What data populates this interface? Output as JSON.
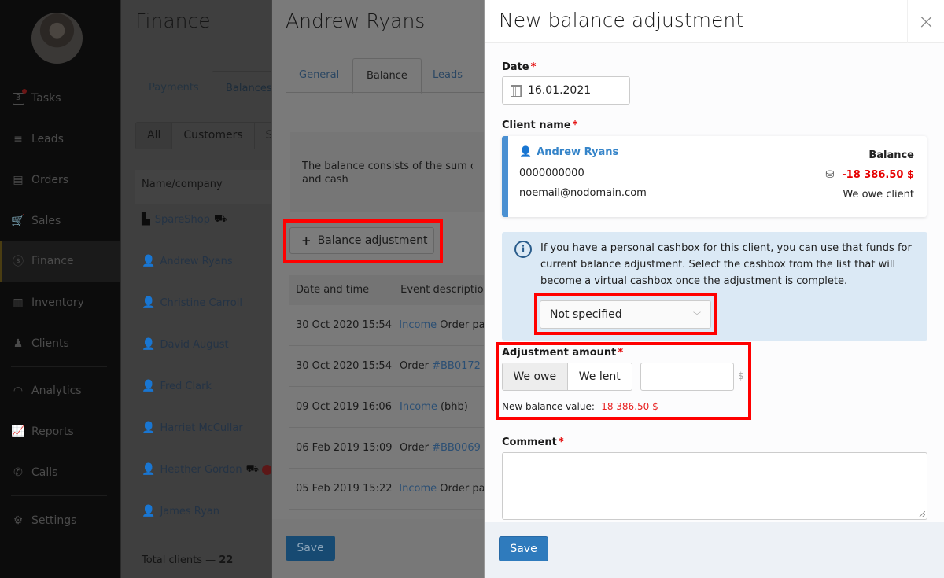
{
  "sidebar": {
    "tasks_count": "3",
    "items": [
      {
        "label": "Tasks",
        "icon": "tasks-icon"
      },
      {
        "label": "Leads",
        "icon": "funnel-icon"
      },
      {
        "label": "Orders",
        "icon": "orders-icon"
      },
      {
        "label": "Sales",
        "icon": "cart-icon"
      },
      {
        "label": "Finance",
        "icon": "dollar-circle-icon",
        "active": true
      },
      {
        "label": "Inventory",
        "icon": "barcode-icon"
      },
      {
        "label": "Clients",
        "icon": "clients-icon"
      },
      {
        "label": "Analytics",
        "icon": "gauge-icon"
      },
      {
        "label": "Reports",
        "icon": "chart-icon"
      },
      {
        "label": "Calls",
        "icon": "phone-icon"
      },
      {
        "label": "Settings",
        "icon": "gear-icon"
      }
    ]
  },
  "finance": {
    "title": "Finance",
    "tabs": [
      "Payments",
      "Balances"
    ],
    "filters": [
      "All",
      "Customers",
      "S"
    ],
    "table_header": "Name/company",
    "clients": [
      {
        "name": "SpareShop",
        "type": "company",
        "truck": true
      },
      {
        "name": "Andrew Ryans",
        "type": "person"
      },
      {
        "name": "Christine Carroll",
        "type": "person"
      },
      {
        "name": "David August",
        "type": "person"
      },
      {
        "name": "Fred Clark",
        "type": "person"
      },
      {
        "name": "Harriet McCullar",
        "type": "person"
      },
      {
        "name": "Heather Gordon",
        "type": "person",
        "truck": true,
        "sad": true
      },
      {
        "name": "James Ryan",
        "type": "person"
      }
    ],
    "total_label": "Total clients —",
    "total_value": "22"
  },
  "client_panel": {
    "title": "Andrew Ryans",
    "tabs": [
      "General",
      "Balance",
      "Leads"
    ],
    "info_text": "The balance consists of the sum of all r and cash",
    "info_line1": "The balance consists of the sum of all r",
    "info_line2": "and cash",
    "adjust_button": "Balance adjustment",
    "table_headers": [
      "Date and time",
      "Event description"
    ],
    "rows": [
      {
        "date": "30 Oct 2020 15:54",
        "link": "Income",
        "text": "Order pa"
      },
      {
        "date": "30 Oct 2020 15:54",
        "text_pre": "Order",
        "link": "#BB0172"
      },
      {
        "date": "09 Oct 2019 16:06",
        "link": "Income",
        "text": "(bhb)"
      },
      {
        "date": "06 Feb 2019 15:09",
        "text_pre": "Order",
        "link": "#BB0069"
      },
      {
        "date": "05 Feb 2019 15:22",
        "link": "Income",
        "text": "Order pa"
      }
    ],
    "save_label": "Save"
  },
  "modal": {
    "title": "New balance adjustment",
    "close_icon": "×",
    "date_label": "Date",
    "date_value": "16.01.2021",
    "client_label": "Client name",
    "client": {
      "name": "Andrew Ryans",
      "phone": "0000000000",
      "email": "noemail@nodomain.com",
      "balance_label": "Balance",
      "balance_value": "-18 386.50 $",
      "balance_note": "We owe client"
    },
    "info_text": "If you have a personal cashbox for this client, you can use that funds for current balance adjustment. Select the cashbox from the list that will become a virtual cashbox once the adjustment is complete.",
    "cashbox_selected": "Not specified",
    "amount_label": "Adjustment amount",
    "toggle_options": [
      "We owe",
      "We lent"
    ],
    "amount_value": "",
    "currency": "$",
    "new_balance_label": "New balance value:",
    "new_balance_value": "-18 386.50 $",
    "comment_label": "Comment",
    "comment_value": "",
    "save_label": "Save",
    "required_mark": "*"
  },
  "colors": {
    "accent": "#2f7bbd",
    "client_stripe": "#4a90d2",
    "negative": "#e60000",
    "highlight": "#ff0000",
    "info_bg": "#dbe9f5"
  }
}
